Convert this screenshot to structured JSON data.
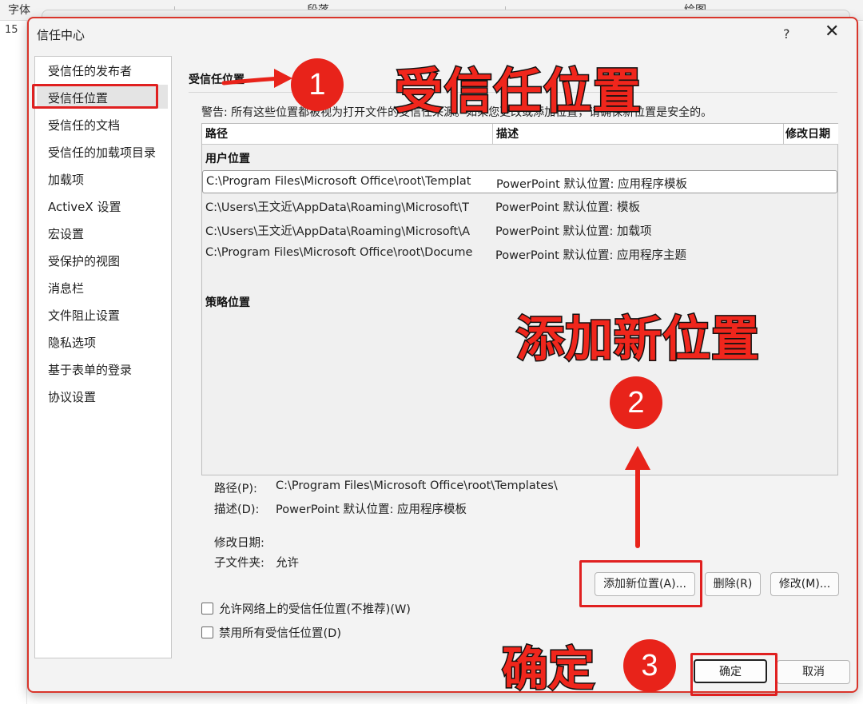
{
  "background": {
    "ribbon_labels": [
      "字体",
      "段落",
      "绘图"
    ],
    "left_fragment": "15"
  },
  "dialog": {
    "title": "信任中心",
    "help": "?",
    "close": "✕"
  },
  "sidebar": {
    "items": [
      {
        "label": "受信任的发布者"
      },
      {
        "label": "受信任位置"
      },
      {
        "label": "受信任的文档"
      },
      {
        "label": "受信任的加载项目录"
      },
      {
        "label": "加载项"
      },
      {
        "label": "ActiveX 设置"
      },
      {
        "label": "宏设置"
      },
      {
        "label": "受保护的视图"
      },
      {
        "label": "消息栏"
      },
      {
        "label": "文件阻止设置"
      },
      {
        "label": "隐私选项"
      },
      {
        "label": "基于表单的登录"
      },
      {
        "label": "协议设置"
      }
    ],
    "selected": "受信任位置"
  },
  "main": {
    "section_title": "受信任位置",
    "warning": "警告: 所有这些位置都被视为打开文件的受信任来源。如果您更改或添加位置，请确保新位置是安全的。",
    "table": {
      "headers": {
        "path": "路径",
        "description": "描述",
        "modified": "修改日期"
      },
      "user_group": "用户位置",
      "policy_group": "策略位置",
      "rows": [
        {
          "path": "C:\\Program Files\\Microsoft Office\\root\\Templat",
          "description": "PowerPoint 默认位置: 应用程序模板"
        },
        {
          "path": "C:\\Users\\王文近\\AppData\\Roaming\\Microsoft\\T",
          "description": "PowerPoint 默认位置: 模板"
        },
        {
          "path": "C:\\Users\\王文近\\AppData\\Roaming\\Microsoft\\A",
          "description": "PowerPoint 默认位置: 加载项"
        },
        {
          "path": "C:\\Program Files\\Microsoft Office\\root\\Docume",
          "description": "PowerPoint 默认位置: 应用程序主题"
        }
      ]
    },
    "details": {
      "path_label": "路径(P):",
      "path_value": "C:\\Program Files\\Microsoft Office\\root\\Templates\\",
      "desc_label": "描述(D):",
      "desc_value": "PowerPoint 默认位置: 应用程序模板",
      "date_label": "修改日期:",
      "subfolder_label": "子文件夹:",
      "subfolder_value": "允许"
    },
    "buttons": {
      "add": "添加新位置(A)...",
      "remove": "删除(R)",
      "modify": "修改(M)..."
    },
    "checkboxes": [
      {
        "label": "允许网络上的受信任位置(不推荐)(W)",
        "checked": false
      },
      {
        "label": "禁用所有受信任位置(D)",
        "checked": false
      }
    ],
    "ok": "确定",
    "cancel": "取消"
  },
  "annotations": {
    "step1_number": "1",
    "step1_text": "受信任位置",
    "step2_number": "2",
    "step2_text": "添加新位置",
    "step3_number": "3",
    "step3_text": "确定",
    "accent_color": "#e8231a"
  }
}
